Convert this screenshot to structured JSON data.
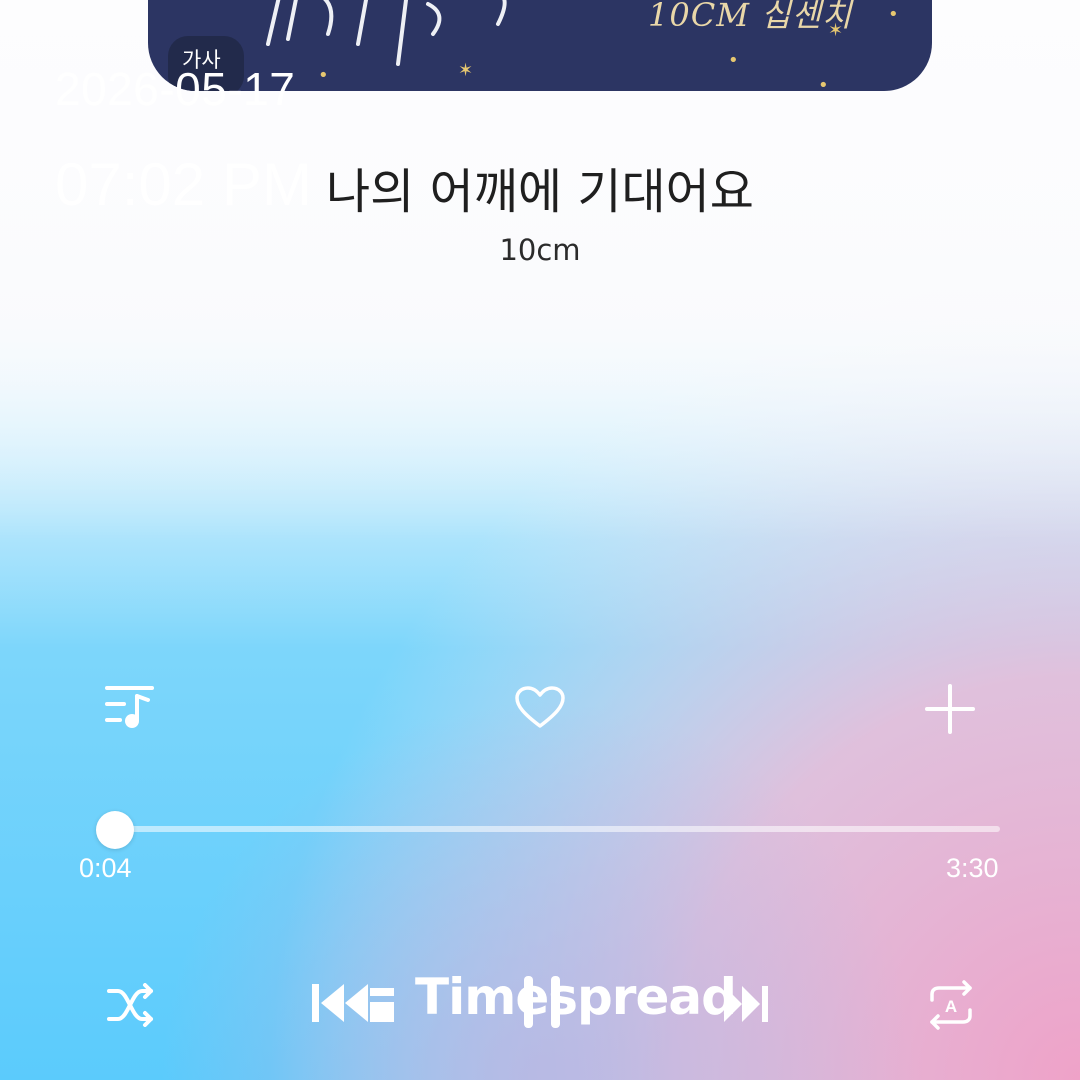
{
  "album": {
    "lyrics_badge": "가사",
    "artist_art_text": "10CM 십센치"
  },
  "overlay": {
    "date": "2026-05-17",
    "time": "07:02 PM"
  },
  "song": {
    "title": "나의 어깨에 기대어요",
    "artist": "10cm"
  },
  "actions": {
    "playlist_icon": "playlist-music-icon",
    "like_icon": "heart-outline-icon",
    "add_icon": "plus-icon"
  },
  "playback": {
    "current_time": "0:04",
    "total_time": "3:30",
    "progress": 0.019
  },
  "controls": {
    "shuffle_icon": "shuffle-icon",
    "prev_icon": "skip-previous-icon",
    "pause_icon": "pause-icon",
    "next_icon": "skip-next-icon",
    "repeat_icon": "repeat-a-icon"
  },
  "watermark": "Timespread",
  "colors": {
    "bg_top": "#fbfbfd",
    "bg_left_blue": "#5fcdfb",
    "bg_right_pink": "#f0a5cb",
    "album_navy": "#2c3563"
  }
}
